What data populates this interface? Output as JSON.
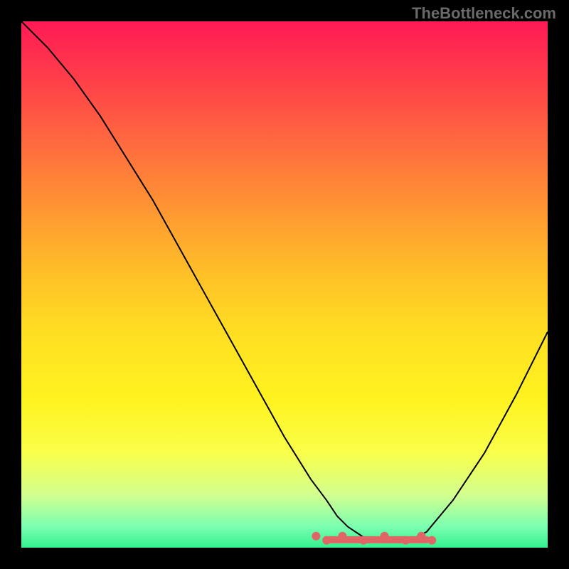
{
  "watermark": "TheBottleneck.com",
  "chart_data": {
    "type": "line",
    "title": "",
    "xlabel": "",
    "ylabel": "",
    "xlim": [
      0,
      100
    ],
    "ylim": [
      0,
      100
    ],
    "series": [
      {
        "name": "curve",
        "color": "#000000",
        "x": [
          0,
          5,
          10,
          15,
          20,
          25,
          30,
          35,
          40,
          45,
          50,
          55,
          58,
          60,
          62,
          65,
          68,
          70,
          73,
          77,
          82,
          88,
          94,
          100
        ],
        "y": [
          100,
          95,
          89,
          82,
          74,
          66,
          57,
          48,
          39,
          30,
          21,
          13,
          9,
          6,
          4,
          2,
          1,
          1,
          1,
          3,
          9,
          18,
          29,
          41
        ]
      }
    ],
    "optimal_region": {
      "color": "#e06666",
      "x_start": 58,
      "x_end": 77,
      "y": 1,
      "markers_x": [
        56,
        58,
        61,
        65,
        69,
        73,
        76,
        78
      ]
    }
  }
}
